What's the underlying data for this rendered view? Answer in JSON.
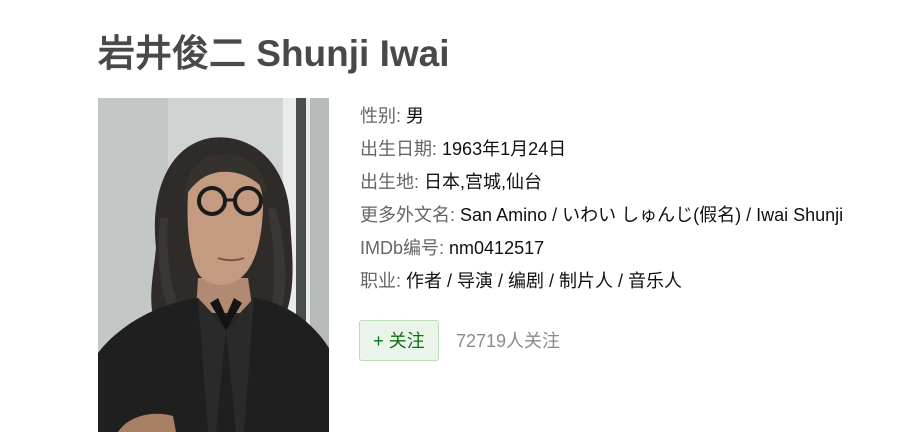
{
  "person": {
    "title": "岩井俊二 Shunji Iwai",
    "photo_alt": "岩井俊二 Shunji Iwai"
  },
  "info": [
    {
      "label": "性别:",
      "value": "男"
    },
    {
      "label": "出生日期:",
      "value": "1963年1月24日"
    },
    {
      "label": "出生地:",
      "value": "日本,宫城,仙台"
    },
    {
      "label": "更多外文名:",
      "value": "San Amino / いわい しゅんじ(假名) / Iwai Shunji"
    },
    {
      "label": "IMDb编号:",
      "value": "nm0412517"
    },
    {
      "label": "职业:",
      "value": "作者 / 导演 / 编剧 / 制片人 / 音乐人"
    }
  ],
  "follow": {
    "button_label": "+ 关注",
    "count_text": "72719人关注"
  },
  "colors": {
    "title": "#494949",
    "label": "#666666",
    "button_bg": "#eaf4ea",
    "button_text": "#0f6e13"
  }
}
